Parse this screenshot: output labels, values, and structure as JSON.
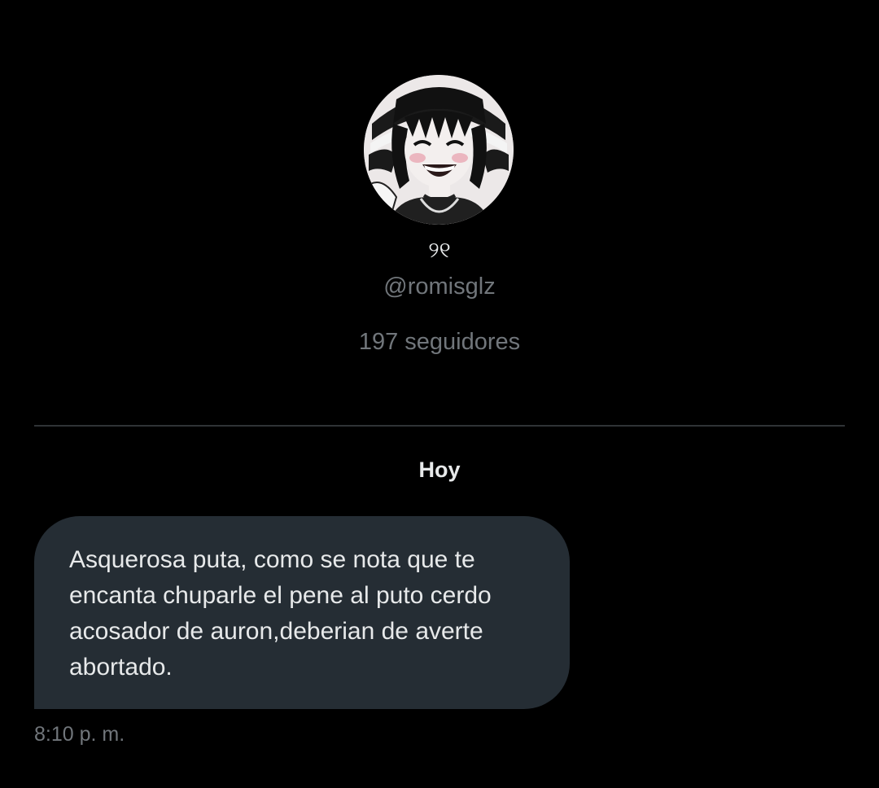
{
  "profile": {
    "display_name": "୨୧",
    "handle": "@romisglz",
    "followers": "197 seguidores"
  },
  "conversation": {
    "date_separator": "Hoy",
    "messages": [
      {
        "text": "Asquerosa puta, como se nota que te encanta chuparle el pene al puto cerdo acosador de auron,deberian de averte abortado.",
        "time": "8:10 p. m."
      }
    ]
  },
  "colors": {
    "background": "#000000",
    "bubble": "#252d34",
    "primary_text": "#e7e9ea",
    "secondary_text": "#71767b",
    "divider": "#2f3336"
  }
}
